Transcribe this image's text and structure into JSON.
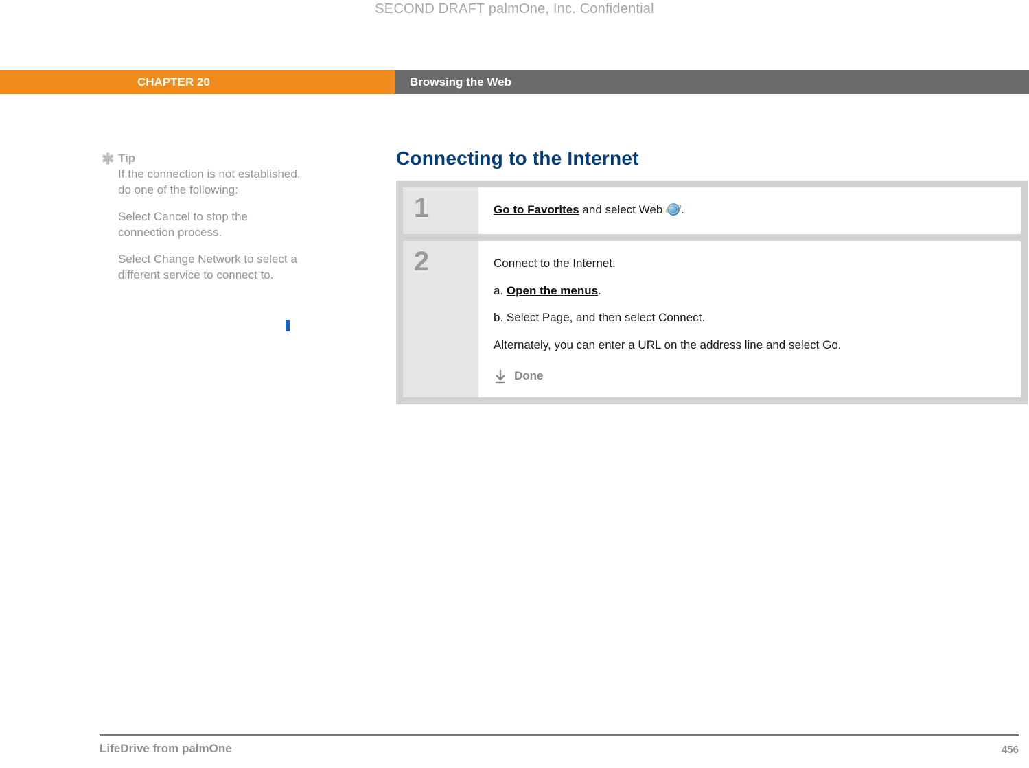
{
  "confidential": "SECOND DRAFT palmOne, Inc.  Confidential",
  "header": {
    "chapter": "CHAPTER 20",
    "title": "Browsing the Web"
  },
  "tip": {
    "label": "Tip",
    "intro": "If the connection is not established, do one of the following:",
    "items": [
      "Select Cancel to stop the connection process.",
      "Select Change Network to select a different service to connect to."
    ]
  },
  "section": {
    "title": "Connecting to the Internet"
  },
  "steps": {
    "s1": {
      "num": "1",
      "link": "Go to Favorites",
      "rest": " and select Web ",
      "period": "."
    },
    "s2": {
      "num": "2",
      "lead": "Connect to the Internet:",
      "a_label": "a.  ",
      "a_link": "Open the menus",
      "a_period": ".",
      "b": "b.  Select Page, and then select Connect.",
      "alt": "Alternately, you can enter a URL on the address line and select Go.",
      "done": "Done"
    }
  },
  "footer": {
    "product": "LifeDrive from palmOne",
    "page": "456"
  }
}
